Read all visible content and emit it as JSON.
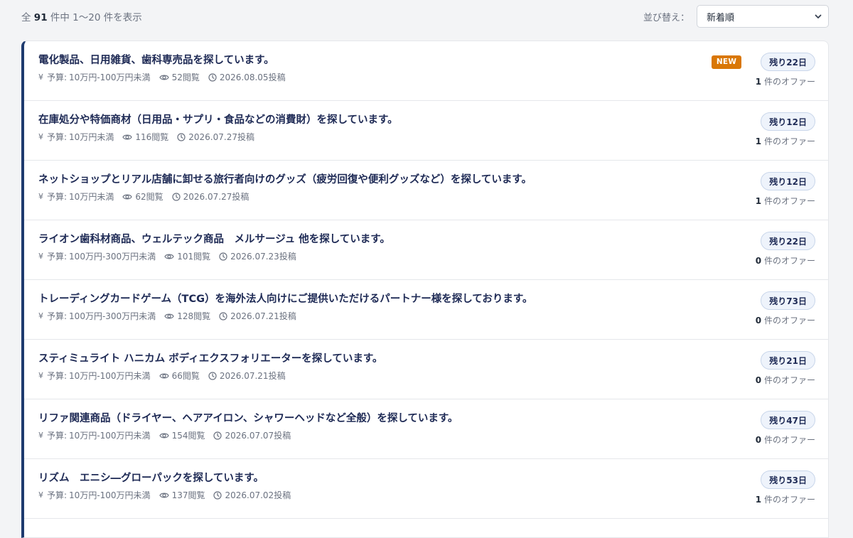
{
  "results": {
    "prefix": "全",
    "total": "91",
    "suffix": "件中 1〜20 件を表示"
  },
  "sort": {
    "label": "並び替え：",
    "selected": "新着順"
  },
  "labels": {
    "budget_prefix": "予算:",
    "views_suffix": "閲覧",
    "posted_suffix": "投稿",
    "offers_suffix": "件のオファー",
    "new_badge": "NEW"
  },
  "icons": {
    "yen": "yen-icon",
    "views": "eye-icon",
    "posted": "clock-icon",
    "sort": "chevron-down-icon"
  },
  "colors": {
    "accent": "#1e3a6e",
    "new_badge": "#d97706"
  },
  "items": [
    {
      "title": "電化製品、日用雑貨、歯科専売品を探しています。",
      "budget": "10万円-100万円未満",
      "views": "52",
      "posted": "2026.08.05",
      "remaining": "残り22日",
      "offers": "1",
      "is_new": true
    },
    {
      "title": "在庫処分や特価商材（日用品・サプリ・食品などの消費財）を探しています。",
      "budget": "10万円未満",
      "views": "116",
      "posted": "2026.07.27",
      "remaining": "残り12日",
      "offers": "1",
      "is_new": false
    },
    {
      "title": "ネットショップとリアル店舗に卸せる旅行者向けのグッズ（疲労回復や便利グッズなど）を探しています。",
      "budget": "10万円未満",
      "views": "62",
      "posted": "2026.07.27",
      "remaining": "残り12日",
      "offers": "1",
      "is_new": false
    },
    {
      "title": "ライオン歯科材商品、ウェルテック商品　メルサージュ 他を探しています。",
      "budget": "100万円-300万円未満",
      "views": "101",
      "posted": "2026.07.23",
      "remaining": "残り22日",
      "offers": "0",
      "is_new": false
    },
    {
      "title": "トレーディングカードゲーム（TCG）を海外法人向けにご提供いただけるパートナー様を探しております。",
      "budget": "100万円-300万円未満",
      "views": "128",
      "posted": "2026.07.21",
      "remaining": "残り73日",
      "offers": "0",
      "is_new": false
    },
    {
      "title": "スティミュライト ハニカム ボディエクスフォリエーターを探しています。",
      "budget": "10万円-100万円未満",
      "views": "66",
      "posted": "2026.07.21",
      "remaining": "残り21日",
      "offers": "0",
      "is_new": false
    },
    {
      "title": "リファ関連商品（ドライヤー、ヘアアイロン、シャワーヘッドなど全般）を探しています。",
      "budget": "10万円-100万円未満",
      "views": "154",
      "posted": "2026.07.07",
      "remaining": "残り47日",
      "offers": "0",
      "is_new": false
    },
    {
      "title": "リズム　エニシ―グローパックを探しています。",
      "budget": "10万円-100万円未満",
      "views": "137",
      "posted": "2026.07.02",
      "remaining": "残り53日",
      "offers": "1",
      "is_new": false
    }
  ]
}
